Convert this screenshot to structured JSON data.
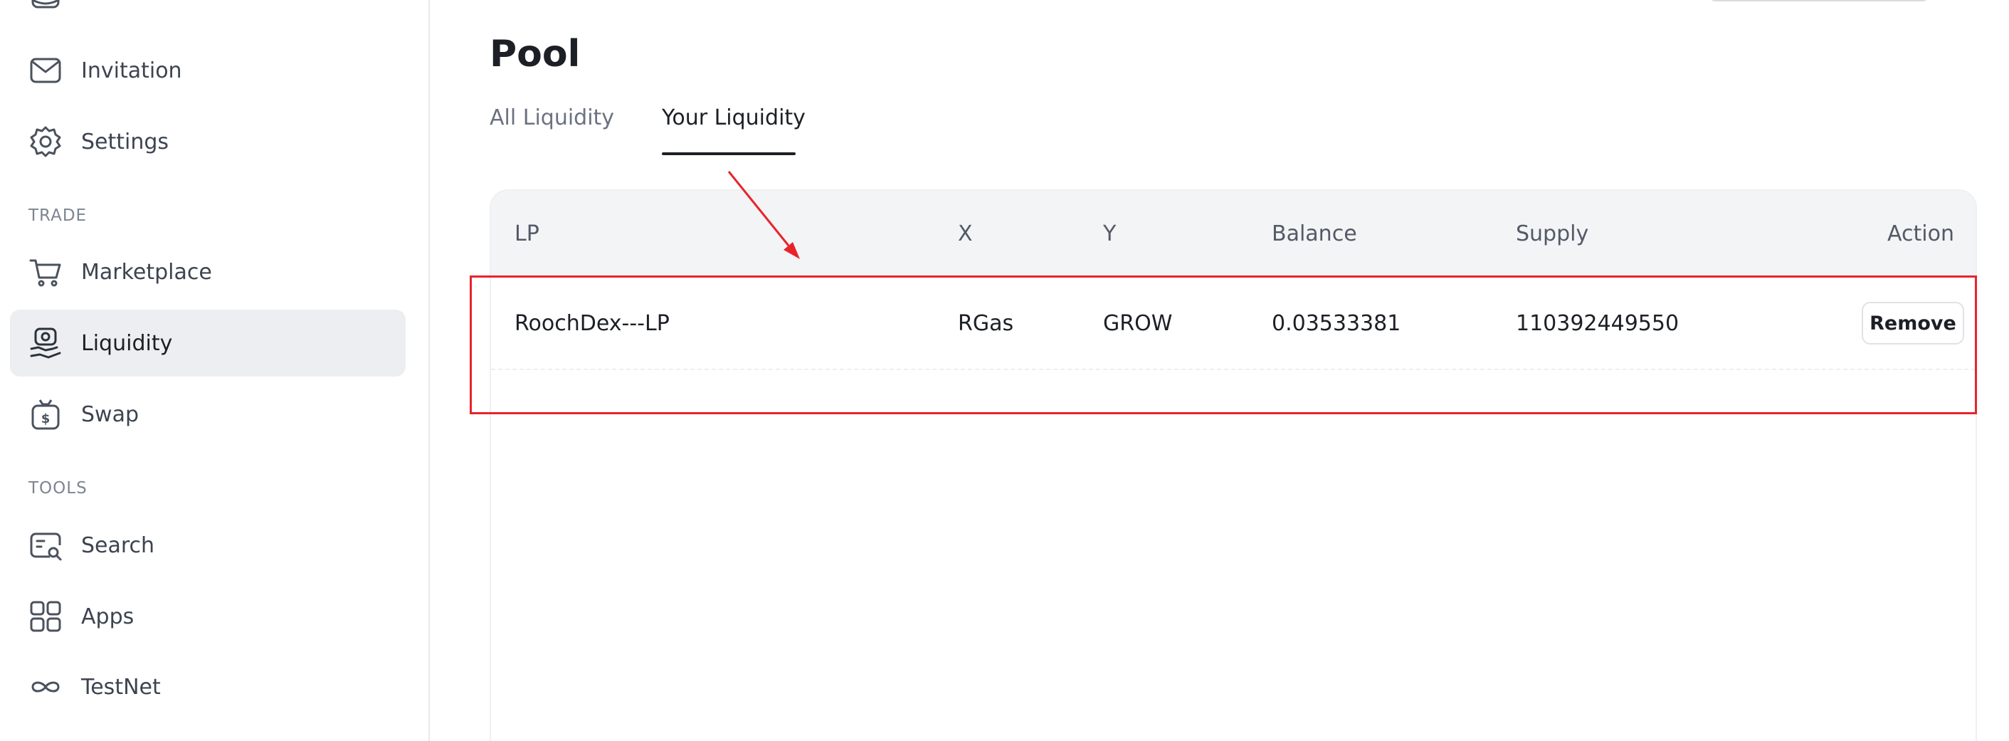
{
  "sidebar": {
    "items_top": [
      {
        "label": "Invitation",
        "icon": "mail-icon"
      },
      {
        "label": "Settings",
        "icon": "gear-icon"
      }
    ],
    "trade_section": {
      "title": "TRADE",
      "items": [
        {
          "label": "Marketplace",
          "icon": "cart-icon"
        },
        {
          "label": "Liquidity",
          "icon": "liquidity-icon",
          "active": true
        },
        {
          "label": "Swap",
          "icon": "dollar-bag-icon"
        }
      ]
    },
    "tools_section": {
      "title": "TOOLS",
      "items": [
        {
          "label": "Search",
          "icon": "search-doc-icon"
        },
        {
          "label": "Apps",
          "icon": "apps-icon"
        },
        {
          "label": "TestNet",
          "icon": "infinity-icon"
        }
      ]
    }
  },
  "main": {
    "title": "Pool",
    "tabs": [
      {
        "label": "All Liquidity",
        "active": false
      },
      {
        "label": "Your Liquidity",
        "active": true
      }
    ],
    "table": {
      "columns": [
        "LP",
        "X",
        "Y",
        "Balance",
        "Supply",
        "Action"
      ],
      "rows": [
        {
          "lp": "RoochDex---LP",
          "x": "RGas",
          "y": "GROW",
          "balance": "0.03533381",
          "supply": "110392449550",
          "action_label": "Remove"
        }
      ]
    }
  },
  "colors": {
    "annotation": "#e8232b",
    "active_nav_bg": "#eceef1",
    "table_header_bg": "#f3f4f6"
  }
}
